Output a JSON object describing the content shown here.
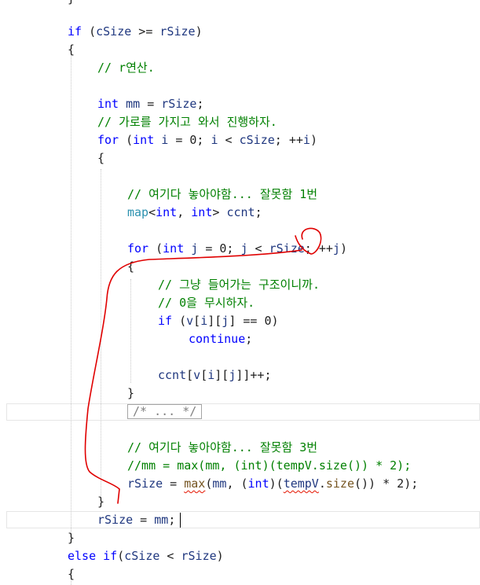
{
  "code": {
    "lines": [
      [
        [
          "pu",
          "}"
        ]
      ],
      [],
      [
        [
          "kw",
          "if"
        ],
        [
          "pu",
          " ("
        ],
        [
          "vr",
          "cSize"
        ],
        [
          "pu",
          " >= "
        ],
        [
          "vr",
          "rSize"
        ],
        [
          "pu",
          ")"
        ]
      ],
      [
        [
          "pu",
          "{"
        ]
      ],
      [
        [
          "cm",
          "// r연산."
        ]
      ],
      [],
      [
        [
          "kw",
          "int"
        ],
        [
          "pu",
          " "
        ],
        [
          "vr",
          "mm"
        ],
        [
          "pu",
          " = "
        ],
        [
          "vr",
          "rSize"
        ],
        [
          "pu",
          ";"
        ]
      ],
      [
        [
          "cm",
          "// 가로를 가지고 와서 진행하자."
        ]
      ],
      [
        [
          "kw",
          "for"
        ],
        [
          "pu",
          " ("
        ],
        [
          "kw",
          "int"
        ],
        [
          "pu",
          " "
        ],
        [
          "vr",
          "i"
        ],
        [
          "pu",
          " = 0; "
        ],
        [
          "vr",
          "i"
        ],
        [
          "pu",
          " < "
        ],
        [
          "vr",
          "cSize"
        ],
        [
          "pu",
          "; ++"
        ],
        [
          "vr",
          "i"
        ],
        [
          "pu",
          ")"
        ]
      ],
      [
        [
          "pu",
          "{"
        ]
      ],
      [],
      [
        [
          "cm",
          "// 여기다 놓아야함... 잘못함 1번"
        ]
      ],
      [
        [
          "ty",
          "map"
        ],
        [
          "pu",
          "<"
        ],
        [
          "kw",
          "int"
        ],
        [
          "pu",
          ", "
        ],
        [
          "kw",
          "int"
        ],
        [
          "pu",
          "> "
        ],
        [
          "vr",
          "ccnt"
        ],
        [
          "pu",
          ";"
        ]
      ],
      [],
      [
        [
          "kw",
          "for"
        ],
        [
          "pu",
          " ("
        ],
        [
          "kw",
          "int"
        ],
        [
          "pu",
          " "
        ],
        [
          "vr",
          "j"
        ],
        [
          "pu",
          " = 0; "
        ],
        [
          "vr",
          "j"
        ],
        [
          "pu",
          " < "
        ],
        [
          "vr",
          "rSize"
        ],
        [
          "pu",
          "; ++"
        ],
        [
          "vr",
          "j"
        ],
        [
          "pu",
          ")"
        ]
      ],
      [
        [
          "pu",
          "{"
        ]
      ],
      [
        [
          "cm",
          "// 그냥 들어가는 구조이니까."
        ]
      ],
      [
        [
          "cm",
          "// 0을 무시하자."
        ]
      ],
      [
        [
          "kw",
          "if"
        ],
        [
          "pu",
          " ("
        ],
        [
          "vr",
          "v"
        ],
        [
          "pu",
          "["
        ],
        [
          "vr",
          "i"
        ],
        [
          "pu",
          "]["
        ],
        [
          "vr",
          "j"
        ],
        [
          "pu",
          "] == 0)"
        ]
      ],
      [
        [
          "kw",
          "continue"
        ],
        [
          "pu",
          ";"
        ]
      ],
      [],
      [
        [
          "vr",
          "ccnt"
        ],
        [
          "pu",
          "["
        ],
        [
          "vr",
          "v"
        ],
        [
          "pu",
          "["
        ],
        [
          "vr",
          "i"
        ],
        [
          "pu",
          "]["
        ],
        [
          "vr",
          "j"
        ],
        [
          "pu",
          "]]++;"
        ]
      ],
      [
        [
          "pu",
          "}"
        ]
      ],
      [],
      [],
      [
        [
          "cm",
          "// 여기다 놓아야함... 잘못함 3번"
        ]
      ],
      [
        [
          "cm",
          "//mm = max(mm, (int)(tempV.size()) * 2);"
        ]
      ],
      [
        [
          "vr",
          "rSize"
        ],
        [
          "pu",
          " = "
        ],
        [
          "fn",
          "max"
        ],
        [
          "pu",
          "("
        ],
        [
          "vr",
          "mm"
        ],
        [
          "pu",
          ", ("
        ],
        [
          "kw",
          "int"
        ],
        [
          "pu",
          ")("
        ],
        [
          "vr",
          "tempV"
        ],
        [
          "pu",
          "."
        ],
        [
          "fn",
          "size"
        ],
        [
          "pu",
          "()) * 2);"
        ]
      ],
      [
        [
          "pu",
          "}"
        ]
      ],
      [
        [
          "vr",
          "rSize"
        ],
        [
          "pu",
          " = "
        ],
        [
          "vr",
          "mm"
        ],
        [
          "pu",
          ";"
        ]
      ],
      [
        [
          "pu",
          "}"
        ]
      ],
      [
        [
          "kw",
          "else"
        ],
        [
          "pu",
          " "
        ],
        [
          "kw",
          "if"
        ],
        [
          "pu",
          "("
        ],
        [
          "vr",
          "cSize"
        ],
        [
          "pu",
          " < "
        ],
        [
          "vr",
          "rSize"
        ],
        [
          "pu",
          ")"
        ]
      ],
      [
        [
          "pu",
          "{"
        ]
      ]
    ],
    "folded_block": "/* ... */"
  },
  "colors": {
    "keyword": "#0000ff",
    "comment": "#008000",
    "function": "#74531f",
    "variable": "#1f377f",
    "type": "#2b91af",
    "plain": "#1e1e1e",
    "annotation_ink": "#e00000"
  }
}
